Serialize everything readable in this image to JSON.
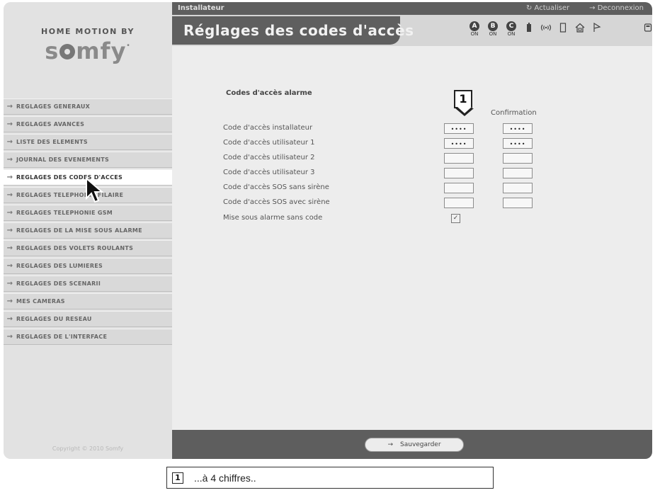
{
  "header": {
    "role": "Installateur",
    "refresh_label": "Actualiser",
    "logout_label": "Deconnexion",
    "page_title": "Réglages des codes d'accès"
  },
  "status": {
    "zones": [
      {
        "letter": "A",
        "state": "ON"
      },
      {
        "letter": "B",
        "state": "ON"
      },
      {
        "letter": "C",
        "state": "ON"
      }
    ]
  },
  "brand": {
    "prefix": "HOME MOTION BY",
    "name": "somfy"
  },
  "sidebar": {
    "items": [
      {
        "label": "REGLAGES GENERAUX"
      },
      {
        "label": "REGLAGES AVANCES"
      },
      {
        "label": "LISTE DES ELEMENTS"
      },
      {
        "label": "JOURNAL DES EVENEMENTS"
      },
      {
        "label": "REGLAGES DES CODES D'ACCES"
      },
      {
        "label": "REGLAGES TELEPHONIE FILAIRE"
      },
      {
        "label": "REGLAGES TELEPHONIE GSM"
      },
      {
        "label": "REGLAGES DE LA MISE SOUS ALARME"
      },
      {
        "label": "REGLAGES DES VOLETS ROULANTS"
      },
      {
        "label": "REGLAGES DES LUMIERES"
      },
      {
        "label": "REGLAGES DES SCENARII"
      },
      {
        "label": "MES CAMERAS"
      },
      {
        "label": "REGLAGES DU RESEAU"
      },
      {
        "label": "REGLAGES DE L'INTERFACE"
      }
    ],
    "copyright": "Copyright © 2010 Somfy"
  },
  "form": {
    "section_title": "Codes d'accès alarme",
    "confirm_header": "Confirmation",
    "callout": "1",
    "rows": [
      {
        "label": "Code d'accès installateur",
        "value": "••••",
        "confirm": "••••"
      },
      {
        "label": "Code d'accès utilisateur 1",
        "value": "••••",
        "confirm": "••••"
      },
      {
        "label": "Code d'accès utilisateur 2",
        "value": "",
        "confirm": ""
      },
      {
        "label": "Code d'accès utilisateur 3",
        "value": "",
        "confirm": ""
      },
      {
        "label": "Code d'accès SOS sans sirène",
        "value": "",
        "confirm": ""
      },
      {
        "label": "Code d'accès SOS avec sirène",
        "value": "",
        "confirm": ""
      }
    ],
    "nocode_label": "Mise sous alarme sans code",
    "nocode_checked": true
  },
  "footer": {
    "save_label": "Sauvegarder"
  },
  "legend": {
    "num": "1",
    "text": "...à 4 chiffres.."
  }
}
